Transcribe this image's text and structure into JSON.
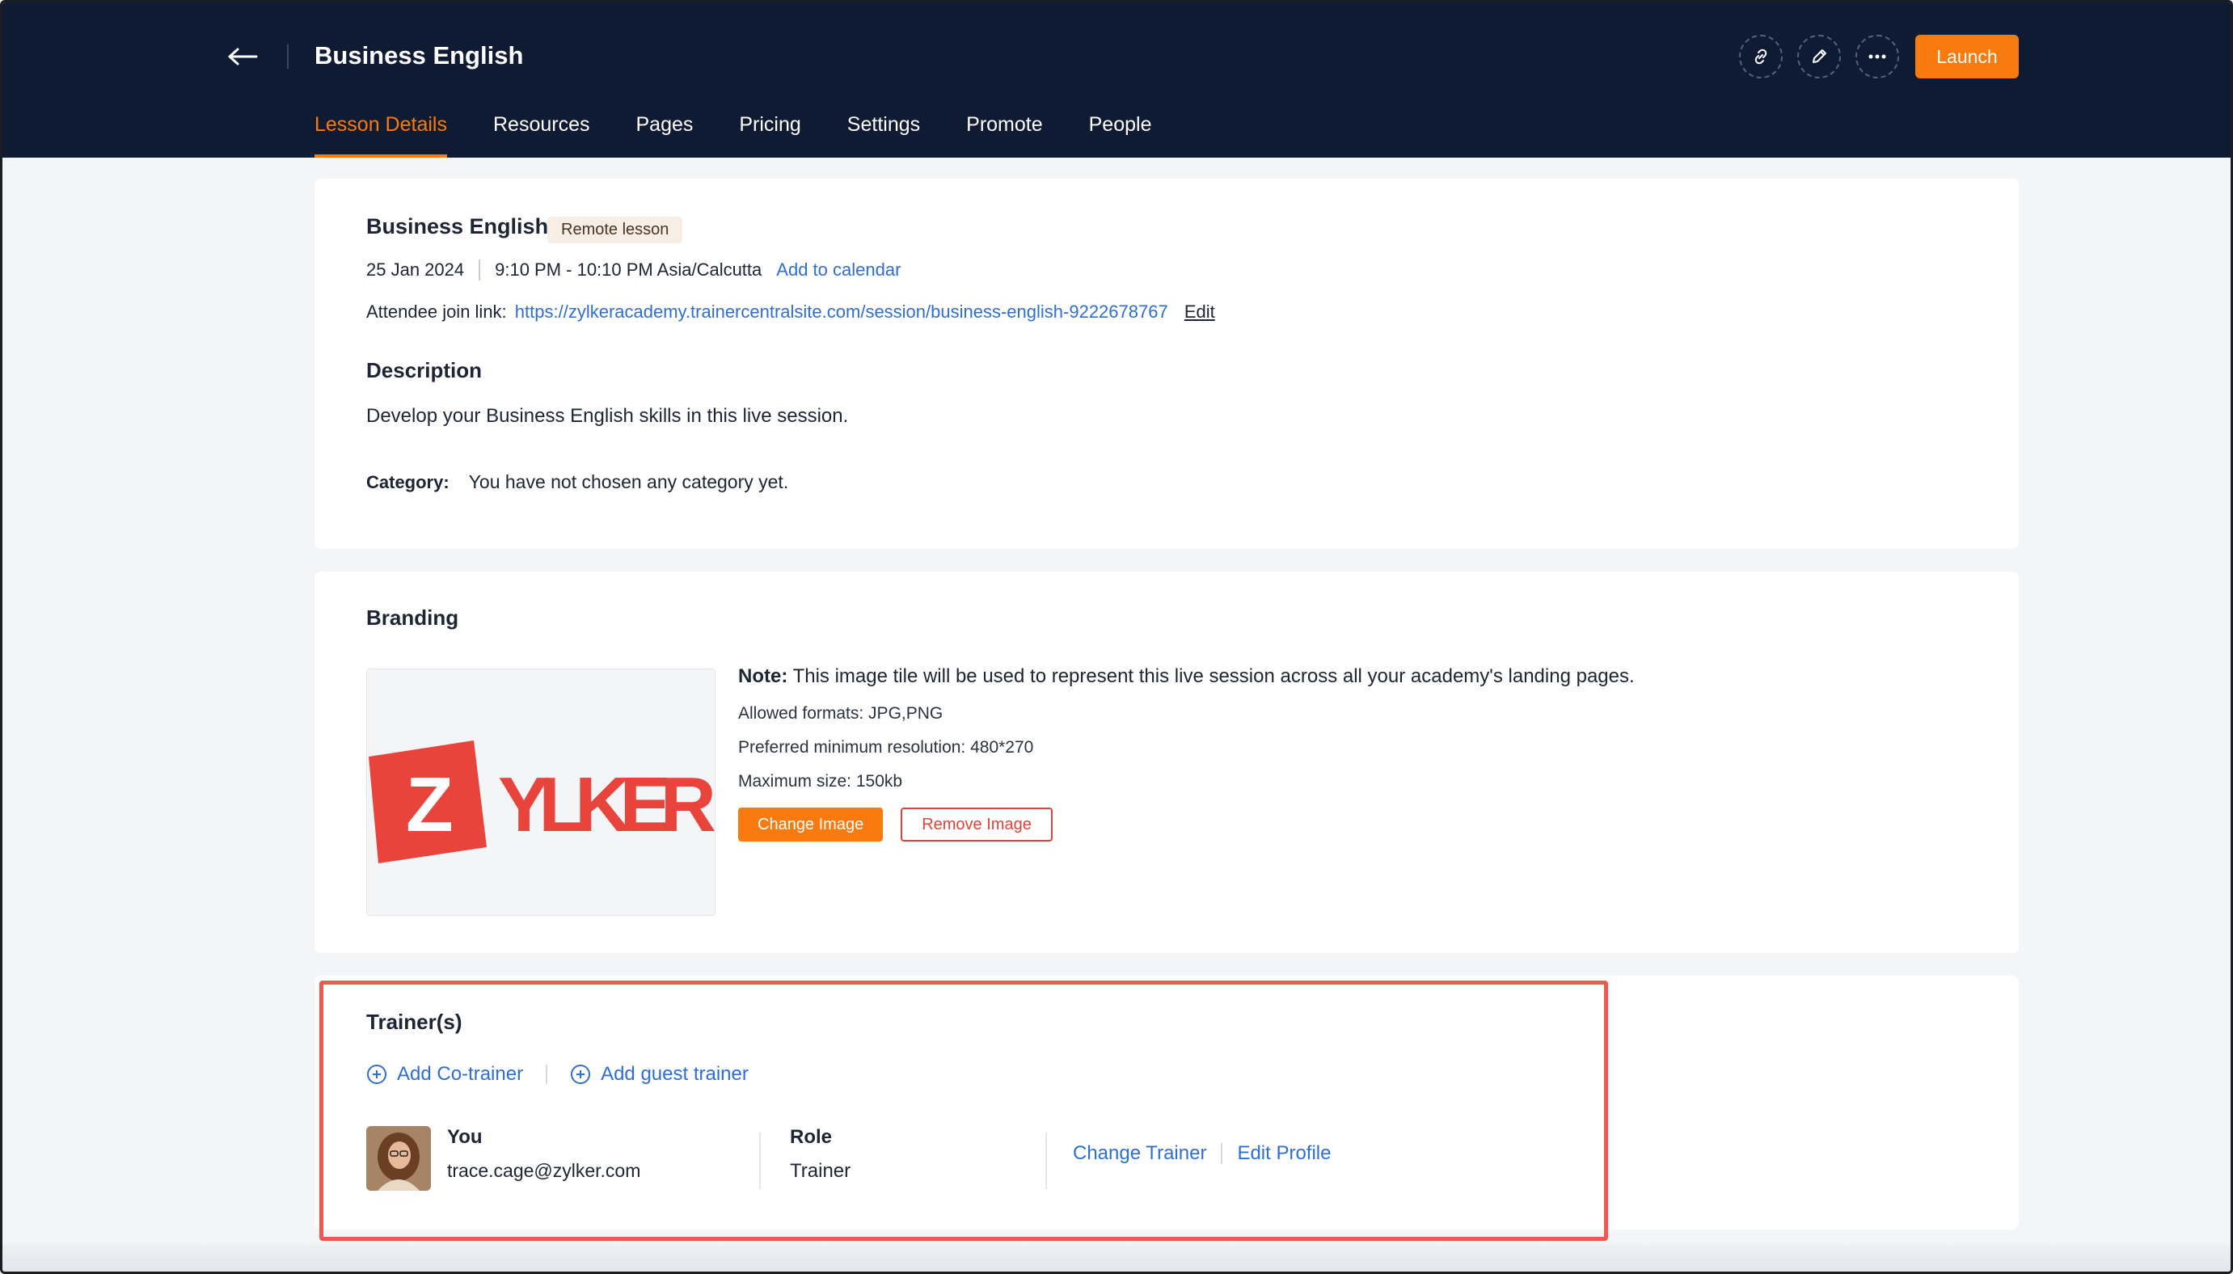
{
  "header": {
    "title": "Business English",
    "launch_label": "Launch",
    "icons": [
      "link-icon",
      "pencil-icon",
      "more-icon"
    ]
  },
  "tabs": [
    {
      "label": "Lesson Details",
      "active": true
    },
    {
      "label": "Resources",
      "active": false
    },
    {
      "label": "Pages",
      "active": false
    },
    {
      "label": "Pricing",
      "active": false
    },
    {
      "label": "Settings",
      "active": false
    },
    {
      "label": "Promote",
      "active": false
    },
    {
      "label": "People",
      "active": false
    }
  ],
  "lesson": {
    "title": "Business English",
    "badge": "Remote lesson",
    "date": "25 Jan 2024",
    "time": "9:10 PM - 10:10 PM Asia/Calcutta",
    "add_calendar": "Add to calendar",
    "join_label": "Attendee join link:",
    "join_url": "https://zylkeracademy.trainercentralsite.com/session/business-english-9222678767",
    "edit_label": "Edit",
    "description_heading": "Description",
    "description": "Develop your Business English skills in this live session.",
    "category_label": "Category:",
    "category_value": "You have not chosen any category yet."
  },
  "branding": {
    "heading": "Branding",
    "logo_text": "YLKER",
    "logo_letter": "Z",
    "note_label": "Note:",
    "note_text": "This image tile will be used to represent this live session across all your academy's landing pages.",
    "formats": "Allowed formats: JPG,PNG",
    "resolution": "Preferred minimum resolution: 480*270",
    "max_size": "Maximum size: 150kb",
    "change_label": "Change Image",
    "remove_label": "Remove Image"
  },
  "trainers": {
    "heading": "Trainer(s)",
    "add_cotrainer": "Add Co-trainer",
    "add_guest": "Add guest trainer",
    "name": "You",
    "email": "trace.cage@zylker.com",
    "role_heading": "Role",
    "role_value": "Trainer",
    "change_trainer": "Change Trainer",
    "edit_profile": "Edit Profile"
  },
  "colors": {
    "header_bg": "#0f1b33",
    "accent": "#f97a0f",
    "link": "#2f6fd1",
    "highlight": "#ee5a4f",
    "logo_red": "#e8443c"
  }
}
